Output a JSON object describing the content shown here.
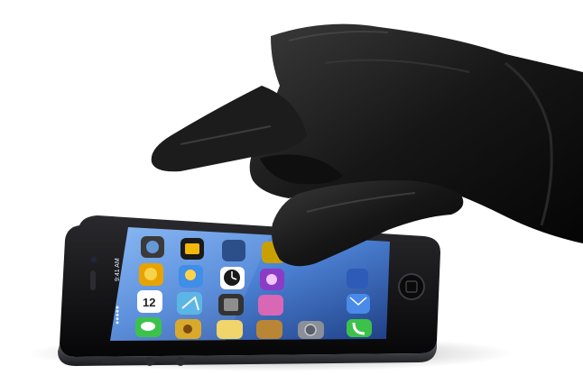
{
  "status_bar": {
    "carrier_signal": "●●●●●",
    "time": "9:41 AM"
  },
  "calendar_icon": {
    "day_number": "12"
  },
  "icons": [
    {
      "name": "game-center-icon",
      "color": "#3a3a3a"
    },
    {
      "name": "photo-app-icon",
      "color": "#e8a300"
    },
    {
      "name": "weather-icon",
      "color": "#3f8ee8"
    },
    {
      "name": "calendar-icon",
      "color": "#ffffff"
    },
    {
      "name": "maps-icon",
      "color": "#5bb6e6"
    },
    {
      "name": "clock-icon",
      "color": "#ffffff"
    },
    {
      "name": "calculator-icon",
      "color": "#333333"
    },
    {
      "name": "itunes-icon",
      "color": "#8b3cc7"
    },
    {
      "name": "messages-icon",
      "color": "#3cc24a"
    },
    {
      "name": "game-icon",
      "color": "#d9a92b"
    },
    {
      "name": "notes-icon",
      "color": "#f1d46a"
    },
    {
      "name": "settings-icon",
      "color": "#8a8f98"
    },
    {
      "name": "mail-icon",
      "color": "#4a8ae8"
    },
    {
      "name": "phone-icon",
      "color": "#3cc24a"
    }
  ],
  "colors": {
    "glove": "#141414",
    "phone_body": "#0e0e10",
    "screen_sky": "#4f86d9"
  }
}
